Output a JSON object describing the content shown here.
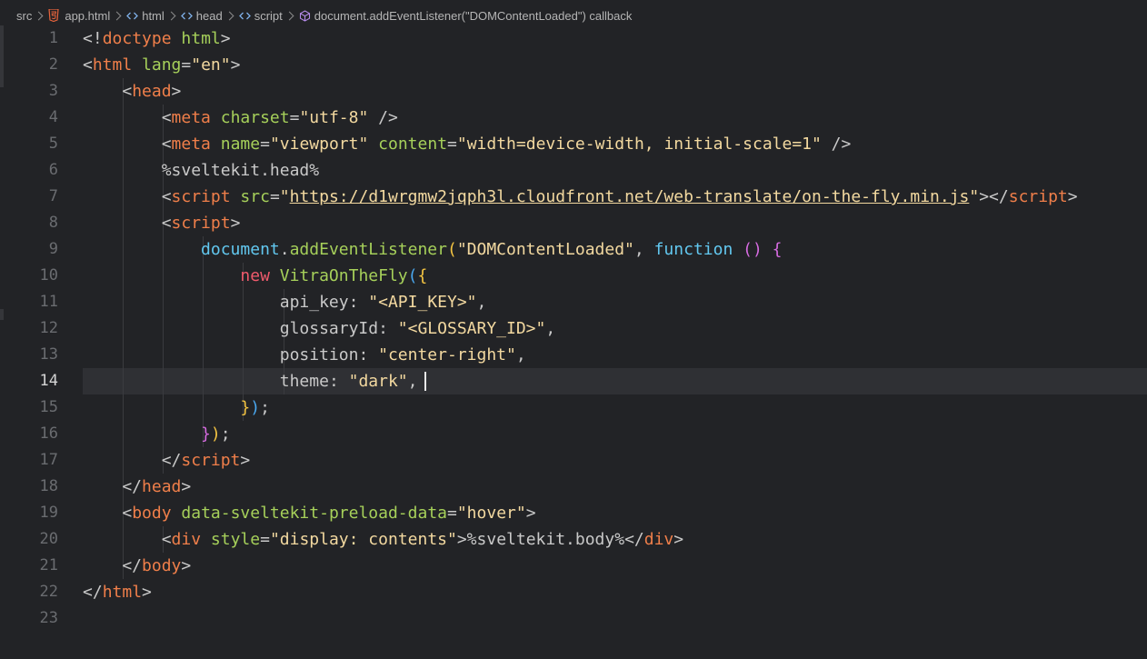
{
  "breadcrumb": {
    "items": [
      {
        "label": "src",
        "icon": "none"
      },
      {
        "label": "app.html",
        "icon": "html5-icon"
      },
      {
        "label": "html",
        "icon": "symbol-tag-icon"
      },
      {
        "label": "head",
        "icon": "symbol-tag-icon"
      },
      {
        "label": "script",
        "icon": "symbol-tag-icon"
      },
      {
        "label": "document.addEventListener(\"DOMContentLoaded\") callback",
        "icon": "symbol-method-icon"
      }
    ]
  },
  "editor": {
    "current_line": 14,
    "line_numbers": [
      "1",
      "2",
      "3",
      "4",
      "5",
      "6",
      "7",
      "8",
      "9",
      "10",
      "11",
      "12",
      "13",
      "14",
      "15",
      "16",
      "17",
      "18",
      "19",
      "20",
      "21",
      "22",
      "23"
    ],
    "lines": [
      [
        {
          "t": "<!",
          "c": "t-punc"
        },
        {
          "t": "doctype",
          "c": "t-kw"
        },
        {
          "t": " ",
          "c": "t-plain"
        },
        {
          "t": "html",
          "c": "t-attr"
        },
        {
          "t": ">",
          "c": "t-punc"
        }
      ],
      [
        {
          "t": "<",
          "c": "t-punc"
        },
        {
          "t": "html",
          "c": "t-tag"
        },
        {
          "t": " ",
          "c": "t-plain"
        },
        {
          "t": "lang",
          "c": "t-attr"
        },
        {
          "t": "=",
          "c": "t-punc"
        },
        {
          "t": "\"en\"",
          "c": "t-str"
        },
        {
          "t": ">",
          "c": "t-punc"
        }
      ],
      [
        {
          "t": "    <",
          "c": "t-punc"
        },
        {
          "t": "head",
          "c": "t-tag"
        },
        {
          "t": ">",
          "c": "t-punc"
        }
      ],
      [
        {
          "t": "        <",
          "c": "t-punc"
        },
        {
          "t": "meta",
          "c": "t-tag"
        },
        {
          "t": " ",
          "c": "t-plain"
        },
        {
          "t": "charset",
          "c": "t-attr"
        },
        {
          "t": "=",
          "c": "t-punc"
        },
        {
          "t": "\"utf-8\"",
          "c": "t-str"
        },
        {
          "t": " />",
          "c": "t-punc"
        }
      ],
      [
        {
          "t": "        <",
          "c": "t-punc"
        },
        {
          "t": "meta",
          "c": "t-tag"
        },
        {
          "t": " ",
          "c": "t-plain"
        },
        {
          "t": "name",
          "c": "t-attr"
        },
        {
          "t": "=",
          "c": "t-punc"
        },
        {
          "t": "\"viewport\"",
          "c": "t-str"
        },
        {
          "t": " ",
          "c": "t-plain"
        },
        {
          "t": "content",
          "c": "t-attr"
        },
        {
          "t": "=",
          "c": "t-punc"
        },
        {
          "t": "\"width=device-width, initial-scale=1\"",
          "c": "t-str"
        },
        {
          "t": " />",
          "c": "t-punc"
        }
      ],
      [
        {
          "t": "        %sveltekit.head%",
          "c": "t-plain"
        }
      ],
      [
        {
          "t": "        <",
          "c": "t-punc"
        },
        {
          "t": "script",
          "c": "t-tag"
        },
        {
          "t": " ",
          "c": "t-plain"
        },
        {
          "t": "src",
          "c": "t-attr"
        },
        {
          "t": "=",
          "c": "t-punc"
        },
        {
          "t": "\"",
          "c": "t-str"
        },
        {
          "t": "https://d1wrgmw2jqph3l.cloudfront.net/web-translate/on-the-fly.min.js",
          "c": "t-url"
        },
        {
          "t": "\"",
          "c": "t-str"
        },
        {
          "t": "></",
          "c": "t-punc"
        },
        {
          "t": "script",
          "c": "t-tag"
        },
        {
          "t": ">",
          "c": "t-punc"
        }
      ],
      [
        {
          "t": "        <",
          "c": "t-punc"
        },
        {
          "t": "script",
          "c": "t-tag"
        },
        {
          "t": ">",
          "c": "t-punc"
        }
      ],
      [
        {
          "t": "            ",
          "c": "t-plain"
        },
        {
          "t": "document",
          "c": "t-ident"
        },
        {
          "t": ".",
          "c": "t-punc"
        },
        {
          "t": "addEventListener",
          "c": "t-fn"
        },
        {
          "t": "(",
          "c": "t-b1"
        },
        {
          "t": "\"DOMContentLoaded\"",
          "c": "t-str"
        },
        {
          "t": ", ",
          "c": "t-punc"
        },
        {
          "t": "function",
          "c": "t-function"
        },
        {
          "t": " ",
          "c": "t-plain"
        },
        {
          "t": "()",
          "c": "t-b2"
        },
        {
          "t": " ",
          "c": "t-plain"
        },
        {
          "t": "{",
          "c": "t-b2"
        }
      ],
      [
        {
          "t": "                ",
          "c": "t-plain"
        },
        {
          "t": "new",
          "c": "t-new"
        },
        {
          "t": " ",
          "c": "t-plain"
        },
        {
          "t": "VitraOnTheFly",
          "c": "t-class"
        },
        {
          "t": "(",
          "c": "t-b3"
        },
        {
          "t": "{",
          "c": "t-b1"
        }
      ],
      [
        {
          "t": "                    api_key",
          "c": "t-prop"
        },
        {
          "t": ": ",
          "c": "t-punc"
        },
        {
          "t": "\"<API_KEY>\"",
          "c": "t-str"
        },
        {
          "t": ",",
          "c": "t-punc"
        }
      ],
      [
        {
          "t": "                    glossaryId",
          "c": "t-prop"
        },
        {
          "t": ": ",
          "c": "t-punc"
        },
        {
          "t": "\"<GLOSSARY_ID>\"",
          "c": "t-str"
        },
        {
          "t": ",",
          "c": "t-punc"
        }
      ],
      [
        {
          "t": "                    position",
          "c": "t-prop"
        },
        {
          "t": ": ",
          "c": "t-punc"
        },
        {
          "t": "\"center-right\"",
          "c": "t-str"
        },
        {
          "t": ",",
          "c": "t-punc"
        }
      ],
      [
        {
          "t": "                    theme",
          "c": "t-prop"
        },
        {
          "t": ": ",
          "c": "t-punc"
        },
        {
          "t": "\"dark\"",
          "c": "t-str"
        },
        {
          "t": ",",
          "c": "t-punc"
        }
      ],
      [
        {
          "t": "                ",
          "c": "t-plain"
        },
        {
          "t": "}",
          "c": "t-b1"
        },
        {
          "t": ")",
          "c": "t-b3"
        },
        {
          "t": ";",
          "c": "t-punc"
        }
      ],
      [
        {
          "t": "            ",
          "c": "t-plain"
        },
        {
          "t": "}",
          "c": "t-b2"
        },
        {
          "t": ")",
          "c": "t-b1"
        },
        {
          "t": ";",
          "c": "t-punc"
        }
      ],
      [
        {
          "t": "        </",
          "c": "t-punc"
        },
        {
          "t": "script",
          "c": "t-tag"
        },
        {
          "t": ">",
          "c": "t-punc"
        }
      ],
      [
        {
          "t": "    </",
          "c": "t-punc"
        },
        {
          "t": "head",
          "c": "t-tag"
        },
        {
          "t": ">",
          "c": "t-punc"
        }
      ],
      [
        {
          "t": "    <",
          "c": "t-punc"
        },
        {
          "t": "body",
          "c": "t-tag"
        },
        {
          "t": " ",
          "c": "t-plain"
        },
        {
          "t": "data-sveltekit-preload-data",
          "c": "t-attr"
        },
        {
          "t": "=",
          "c": "t-punc"
        },
        {
          "t": "\"hover\"",
          "c": "t-str"
        },
        {
          "t": ">",
          "c": "t-punc"
        }
      ],
      [
        {
          "t": "        <",
          "c": "t-punc"
        },
        {
          "t": "div",
          "c": "t-tag"
        },
        {
          "t": " ",
          "c": "t-plain"
        },
        {
          "t": "style",
          "c": "t-attr"
        },
        {
          "t": "=",
          "c": "t-punc"
        },
        {
          "t": "\"display: contents\"",
          "c": "t-str"
        },
        {
          "t": ">%sveltekit.body%</",
          "c": "t-punc"
        },
        {
          "t": "div",
          "c": "t-tag"
        },
        {
          "t": ">",
          "c": "t-punc"
        }
      ],
      [
        {
          "t": "    </",
          "c": "t-punc"
        },
        {
          "t": "body",
          "c": "t-tag"
        },
        {
          "t": ">",
          "c": "t-punc"
        }
      ],
      [
        {
          "t": "</",
          "c": "t-punc"
        },
        {
          "t": "html",
          "c": "t-tag"
        },
        {
          "t": ">",
          "c": "t-punc"
        }
      ],
      []
    ]
  },
  "colors": {
    "background": "#222326",
    "current_line": "#2f3034",
    "tag": "#f07f4a",
    "attribute": "#a6d05a",
    "string": "#f3d9a0",
    "identifier": "#62c8f0"
  }
}
